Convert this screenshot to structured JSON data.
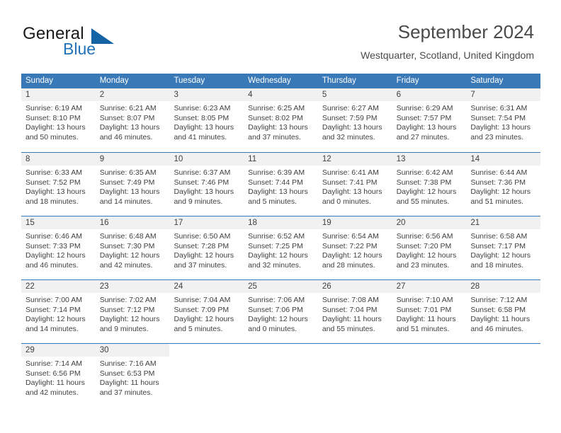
{
  "brand": {
    "name_part1": "General",
    "name_part2": "Blue",
    "logo_icon": "blue-triangle-logo"
  },
  "header": {
    "title": "September 2024",
    "subtitle": "Westquarter, Scotland, United Kingdom"
  },
  "theme": {
    "header_blue": "#3a79b8",
    "daynum_band": "#f1f1f1",
    "text": "#3f3f3f",
    "brand_blue": "#2272b8"
  },
  "weekdays": [
    "Sunday",
    "Monday",
    "Tuesday",
    "Wednesday",
    "Thursday",
    "Friday",
    "Saturday"
  ],
  "weeks": [
    [
      {
        "day": "1",
        "sunrise": "Sunrise: 6:19 AM",
        "sunset": "Sunset: 8:10 PM",
        "daylight1": "Daylight: 13 hours",
        "daylight2": "and 50 minutes."
      },
      {
        "day": "2",
        "sunrise": "Sunrise: 6:21 AM",
        "sunset": "Sunset: 8:07 PM",
        "daylight1": "Daylight: 13 hours",
        "daylight2": "and 46 minutes."
      },
      {
        "day": "3",
        "sunrise": "Sunrise: 6:23 AM",
        "sunset": "Sunset: 8:05 PM",
        "daylight1": "Daylight: 13 hours",
        "daylight2": "and 41 minutes."
      },
      {
        "day": "4",
        "sunrise": "Sunrise: 6:25 AM",
        "sunset": "Sunset: 8:02 PM",
        "daylight1": "Daylight: 13 hours",
        "daylight2": "and 37 minutes."
      },
      {
        "day": "5",
        "sunrise": "Sunrise: 6:27 AM",
        "sunset": "Sunset: 7:59 PM",
        "daylight1": "Daylight: 13 hours",
        "daylight2": "and 32 minutes."
      },
      {
        "day": "6",
        "sunrise": "Sunrise: 6:29 AM",
        "sunset": "Sunset: 7:57 PM",
        "daylight1": "Daylight: 13 hours",
        "daylight2": "and 27 minutes."
      },
      {
        "day": "7",
        "sunrise": "Sunrise: 6:31 AM",
        "sunset": "Sunset: 7:54 PM",
        "daylight1": "Daylight: 13 hours",
        "daylight2": "and 23 minutes."
      }
    ],
    [
      {
        "day": "8",
        "sunrise": "Sunrise: 6:33 AM",
        "sunset": "Sunset: 7:52 PM",
        "daylight1": "Daylight: 13 hours",
        "daylight2": "and 18 minutes."
      },
      {
        "day": "9",
        "sunrise": "Sunrise: 6:35 AM",
        "sunset": "Sunset: 7:49 PM",
        "daylight1": "Daylight: 13 hours",
        "daylight2": "and 14 minutes."
      },
      {
        "day": "10",
        "sunrise": "Sunrise: 6:37 AM",
        "sunset": "Sunset: 7:46 PM",
        "daylight1": "Daylight: 13 hours",
        "daylight2": "and 9 minutes."
      },
      {
        "day": "11",
        "sunrise": "Sunrise: 6:39 AM",
        "sunset": "Sunset: 7:44 PM",
        "daylight1": "Daylight: 13 hours",
        "daylight2": "and 5 minutes."
      },
      {
        "day": "12",
        "sunrise": "Sunrise: 6:41 AM",
        "sunset": "Sunset: 7:41 PM",
        "daylight1": "Daylight: 13 hours",
        "daylight2": "and 0 minutes."
      },
      {
        "day": "13",
        "sunrise": "Sunrise: 6:42 AM",
        "sunset": "Sunset: 7:38 PM",
        "daylight1": "Daylight: 12 hours",
        "daylight2": "and 55 minutes."
      },
      {
        "day": "14",
        "sunrise": "Sunrise: 6:44 AM",
        "sunset": "Sunset: 7:36 PM",
        "daylight1": "Daylight: 12 hours",
        "daylight2": "and 51 minutes."
      }
    ],
    [
      {
        "day": "15",
        "sunrise": "Sunrise: 6:46 AM",
        "sunset": "Sunset: 7:33 PM",
        "daylight1": "Daylight: 12 hours",
        "daylight2": "and 46 minutes."
      },
      {
        "day": "16",
        "sunrise": "Sunrise: 6:48 AM",
        "sunset": "Sunset: 7:30 PM",
        "daylight1": "Daylight: 12 hours",
        "daylight2": "and 42 minutes."
      },
      {
        "day": "17",
        "sunrise": "Sunrise: 6:50 AM",
        "sunset": "Sunset: 7:28 PM",
        "daylight1": "Daylight: 12 hours",
        "daylight2": "and 37 minutes."
      },
      {
        "day": "18",
        "sunrise": "Sunrise: 6:52 AM",
        "sunset": "Sunset: 7:25 PM",
        "daylight1": "Daylight: 12 hours",
        "daylight2": "and 32 minutes."
      },
      {
        "day": "19",
        "sunrise": "Sunrise: 6:54 AM",
        "sunset": "Sunset: 7:22 PM",
        "daylight1": "Daylight: 12 hours",
        "daylight2": "and 28 minutes."
      },
      {
        "day": "20",
        "sunrise": "Sunrise: 6:56 AM",
        "sunset": "Sunset: 7:20 PM",
        "daylight1": "Daylight: 12 hours",
        "daylight2": "and 23 minutes."
      },
      {
        "day": "21",
        "sunrise": "Sunrise: 6:58 AM",
        "sunset": "Sunset: 7:17 PM",
        "daylight1": "Daylight: 12 hours",
        "daylight2": "and 18 minutes."
      }
    ],
    [
      {
        "day": "22",
        "sunrise": "Sunrise: 7:00 AM",
        "sunset": "Sunset: 7:14 PM",
        "daylight1": "Daylight: 12 hours",
        "daylight2": "and 14 minutes."
      },
      {
        "day": "23",
        "sunrise": "Sunrise: 7:02 AM",
        "sunset": "Sunset: 7:12 PM",
        "daylight1": "Daylight: 12 hours",
        "daylight2": "and 9 minutes."
      },
      {
        "day": "24",
        "sunrise": "Sunrise: 7:04 AM",
        "sunset": "Sunset: 7:09 PM",
        "daylight1": "Daylight: 12 hours",
        "daylight2": "and 5 minutes."
      },
      {
        "day": "25",
        "sunrise": "Sunrise: 7:06 AM",
        "sunset": "Sunset: 7:06 PM",
        "daylight1": "Daylight: 12 hours",
        "daylight2": "and 0 minutes."
      },
      {
        "day": "26",
        "sunrise": "Sunrise: 7:08 AM",
        "sunset": "Sunset: 7:04 PM",
        "daylight1": "Daylight: 11 hours",
        "daylight2": "and 55 minutes."
      },
      {
        "day": "27",
        "sunrise": "Sunrise: 7:10 AM",
        "sunset": "Sunset: 7:01 PM",
        "daylight1": "Daylight: 11 hours",
        "daylight2": "and 51 minutes."
      },
      {
        "day": "28",
        "sunrise": "Sunrise: 7:12 AM",
        "sunset": "Sunset: 6:58 PM",
        "daylight1": "Daylight: 11 hours",
        "daylight2": "and 46 minutes."
      }
    ],
    [
      {
        "day": "29",
        "sunrise": "Sunrise: 7:14 AM",
        "sunset": "Sunset: 6:56 PM",
        "daylight1": "Daylight: 11 hours",
        "daylight2": "and 42 minutes."
      },
      {
        "day": "30",
        "sunrise": "Sunrise: 7:16 AM",
        "sunset": "Sunset: 6:53 PM",
        "daylight1": "Daylight: 11 hours",
        "daylight2": "and 37 minutes."
      },
      {
        "day": "",
        "sunrise": "",
        "sunset": "",
        "daylight1": "",
        "daylight2": ""
      },
      {
        "day": "",
        "sunrise": "",
        "sunset": "",
        "daylight1": "",
        "daylight2": ""
      },
      {
        "day": "",
        "sunrise": "",
        "sunset": "",
        "daylight1": "",
        "daylight2": ""
      },
      {
        "day": "",
        "sunrise": "",
        "sunset": "",
        "daylight1": "",
        "daylight2": ""
      },
      {
        "day": "",
        "sunrise": "",
        "sunset": "",
        "daylight1": "",
        "daylight2": ""
      }
    ]
  ]
}
